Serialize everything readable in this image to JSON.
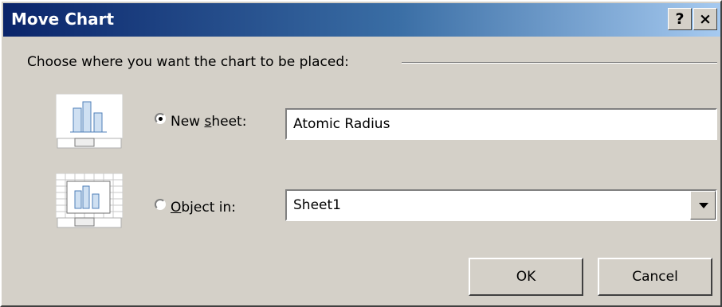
{
  "window": {
    "title": "Move Chart",
    "help_label": "?",
    "close_label": "×"
  },
  "group": {
    "label": "Choose where you want the chart to be placed:"
  },
  "option_new_sheet": {
    "label_pre": "New ",
    "label_accel": "s",
    "label_post": "heet:",
    "selected": true,
    "value": "Atomic Radius"
  },
  "option_object_in": {
    "label_pre": "",
    "label_accel": "O",
    "label_post": "bject in:",
    "selected": false,
    "value": "Sheet1"
  },
  "buttons": {
    "ok": "OK",
    "cancel": "Cancel"
  },
  "colors": {
    "title_start": "#0a246a",
    "title_end": "#a6caf0",
    "face": "#d4d0c8"
  }
}
